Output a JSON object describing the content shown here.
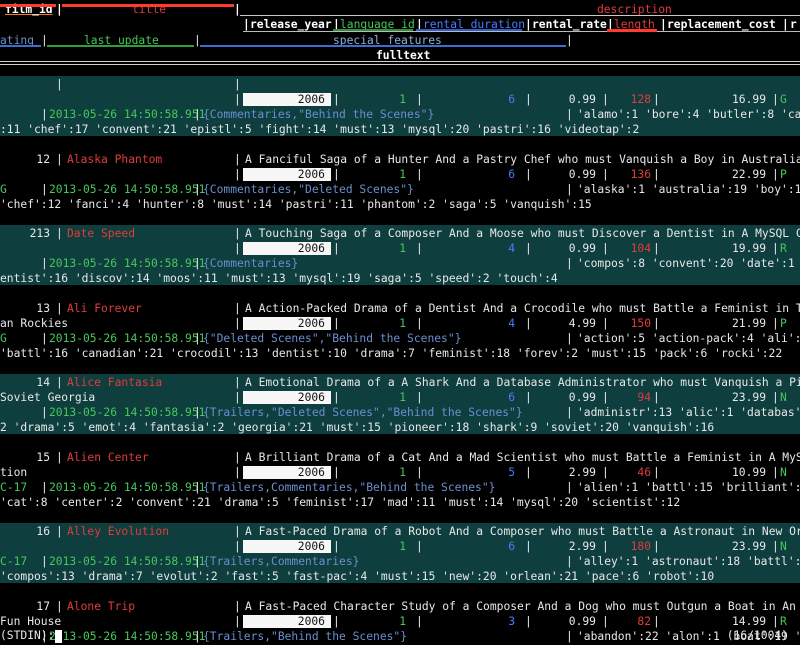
{
  "headers": {
    "film_id": "film_id",
    "title": "title",
    "description": "description",
    "release_year": "release_year",
    "language_id": "language_id",
    "rental_duration": "rental_duration",
    "rental_rate": "rental_rate",
    "length": "length",
    "replacement_cost": "replacement_cost",
    "rating": "ating",
    "last_update": "last_update",
    "special_features": "special_features",
    "fulltext": "fulltext"
  },
  "rows": [
    {
      "film_id": "",
      "title": "",
      "description": "",
      "year": "2006",
      "lang": "1",
      "dur": "6",
      "rate": "0.99",
      "len": "128",
      "cost": "16.99",
      "rating_tail": "G",
      "rating_head": "",
      "update": "2013-05-26 14:50:58.951",
      "features": "{Commentaries,\"Behind the Scenes\"}",
      "fulltext_head": "'alamo':1 'bore':4 'butler':8 'cat'",
      "fulltext_tail": ":11 'chef':17 'convent':21 'epistl':5 'fight':14 'must':13 'mysql':20 'pastri':16 'videotap':2",
      "title_wrap": ""
    },
    {
      "film_id": "12",
      "title": "Alaska Phantom",
      "description": "A Fanciful Saga of a Hunter And a Pastry Chef who must Vanquish a Boy in Australia",
      "year": "2006",
      "lang": "1",
      "dur": "6",
      "rate": "0.99",
      "len": "136",
      "cost": "22.99",
      "rating_tail": "P",
      "rating_head": "G",
      "update": "2013-05-26 14:50:58.951",
      "features": "{Commentaries,\"Deleted Scenes\"}",
      "fulltext_head": "'alaska':1 'australia':19 'boy':17",
      "fulltext_tail": "'chef':12 'fanci':4 'hunter':8 'must':14 'pastri':11 'phantom':2 'saga':5 'vanquish':15",
      "title_wrap": ""
    },
    {
      "film_id": "213",
      "title": "Date Speed",
      "description": "A Touching Saga of a Composer And a Moose who must Discover a Dentist in A MySQL Convention",
      "year": "2006",
      "lang": "1",
      "dur": "4",
      "rate": "0.99",
      "len": "104",
      "cost": "19.99",
      "rating_tail": "R",
      "rating_head": "",
      "update": "2013-05-26 14:50:58.951",
      "features": "{Commentaries}",
      "fulltext_head": "'compos':8 'convent':20 'date':1 'd",
      "fulltext_tail": "entist':16 'discov':14 'moos':11 'must':13 'mysql':19 'saga':5 'speed':2 'touch':4",
      "title_wrap": ""
    },
    {
      "film_id": "13",
      "title": "Ali Forever",
      "description": "A Action-Packed Drama of a Dentist And a Crocodile who must Battle a Feminist in The Canadi",
      "year": "2006",
      "lang": "1",
      "dur": "4",
      "rate": "4.99",
      "len": "150",
      "cost": "21.99",
      "rating_tail": "P",
      "rating_head": "G",
      "update": "2013-05-26 14:50:58.951",
      "features": "{\"Deleted Scenes\",\"Behind the Scenes\"}",
      "fulltext_head": "'action':5 'action-pack':4 'ali':1",
      "fulltext_tail": "'battl':16 'canadian':21 'crocodil':13 'dentist':10 'drama':7 'feminist':18 'forev':2 'must':15 'pack':6 'rocki':22",
      "title_wrap": "an Rockies"
    },
    {
      "film_id": "14",
      "title": "Alice Fantasia",
      "description": "A Emotional Drama of a A Shark And a Database Administrator who must Vanquish a Pioneer in",
      "year": "2006",
      "lang": "1",
      "dur": "6",
      "rate": "0.99",
      "len": "94",
      "cost": "23.99",
      "rating_tail": "N",
      "rating_head": "",
      "update": "2013-05-26 14:50:58.951",
      "features": "{Trailers,\"Deleted Scenes\",\"Behind the Scenes\"}",
      "fulltext_head": "'administr':13 'alic':1 'databas':1",
      "fulltext_tail": "2 'drama':5 'emot':4 'fantasia':2 'georgia':21 'must':15 'pioneer':18 'shark':9 'soviet':20 'vanquish':16",
      "title_wrap": "Soviet Georgia"
    },
    {
      "film_id": "15",
      "title": "Alien Center",
      "description": "A Brilliant Drama of a Cat And a Mad Scientist who must Battle a Feminist in A MySQL Conven",
      "year": "2006",
      "lang": "1",
      "dur": "5",
      "rate": "2.99",
      "len": "46",
      "cost": "10.99",
      "rating_tail": "N",
      "rating_head": "C-17",
      "update": "2013-05-26 14:50:58.951",
      "features": "{Trailers,Commentaries,\"Behind the Scenes\"}",
      "fulltext_head": "'alien':1 'battl':15 'brilliant':4",
      "fulltext_tail": "'cat':8 'center':2 'convent':21 'drama':5 'feminist':17 'mad':11 'must':14 'mysql':20 'scientist':12",
      "title_wrap": "tion"
    },
    {
      "film_id": "16",
      "title": "Alley Evolution",
      "description": "A Fast-Paced Drama of a Robot And a Composer who must Battle a Astronaut in New Orleans",
      "year": "2006",
      "lang": "1",
      "dur": "6",
      "rate": "2.99",
      "len": "180",
      "cost": "23.99",
      "rating_tail": "N",
      "rating_head": "C-17",
      "update": "2013-05-26 14:50:58.951",
      "features": "{Trailers,Commentaries}",
      "fulltext_head": "'alley':1 'astronaut':18 'battl':16",
      "fulltext_tail": "'compos':13 'drama':7 'evolut':2 'fast':5 'fast-pac':4 'must':15 'new':20 'orlean':21 'pace':6 'robot':10",
      "title_wrap": ""
    },
    {
      "film_id": "17",
      "title": "Alone Trip",
      "description": "A Fast-Paced Character Study of a Composer And a Dog who must Outgun a Boat in An Abandoned",
      "year": "2006",
      "lang": "1",
      "dur": "3",
      "rate": "0.99",
      "len": "82",
      "cost": "14.99",
      "rating_tail": "R",
      "rating_head": "",
      "update": "2013-05-26 14:50:58.951",
      "features": "{Trailers,\"Behind the Scenes\"}",
      "fulltext_head": "'abandon':22 'alon':1 'boat':19 'ch",
      "fulltext_tail": "",
      "title_wrap": "Fun House"
    }
  ],
  "status": {
    "prompt": "(STDIN):",
    "position": "(16/1004)"
  }
}
